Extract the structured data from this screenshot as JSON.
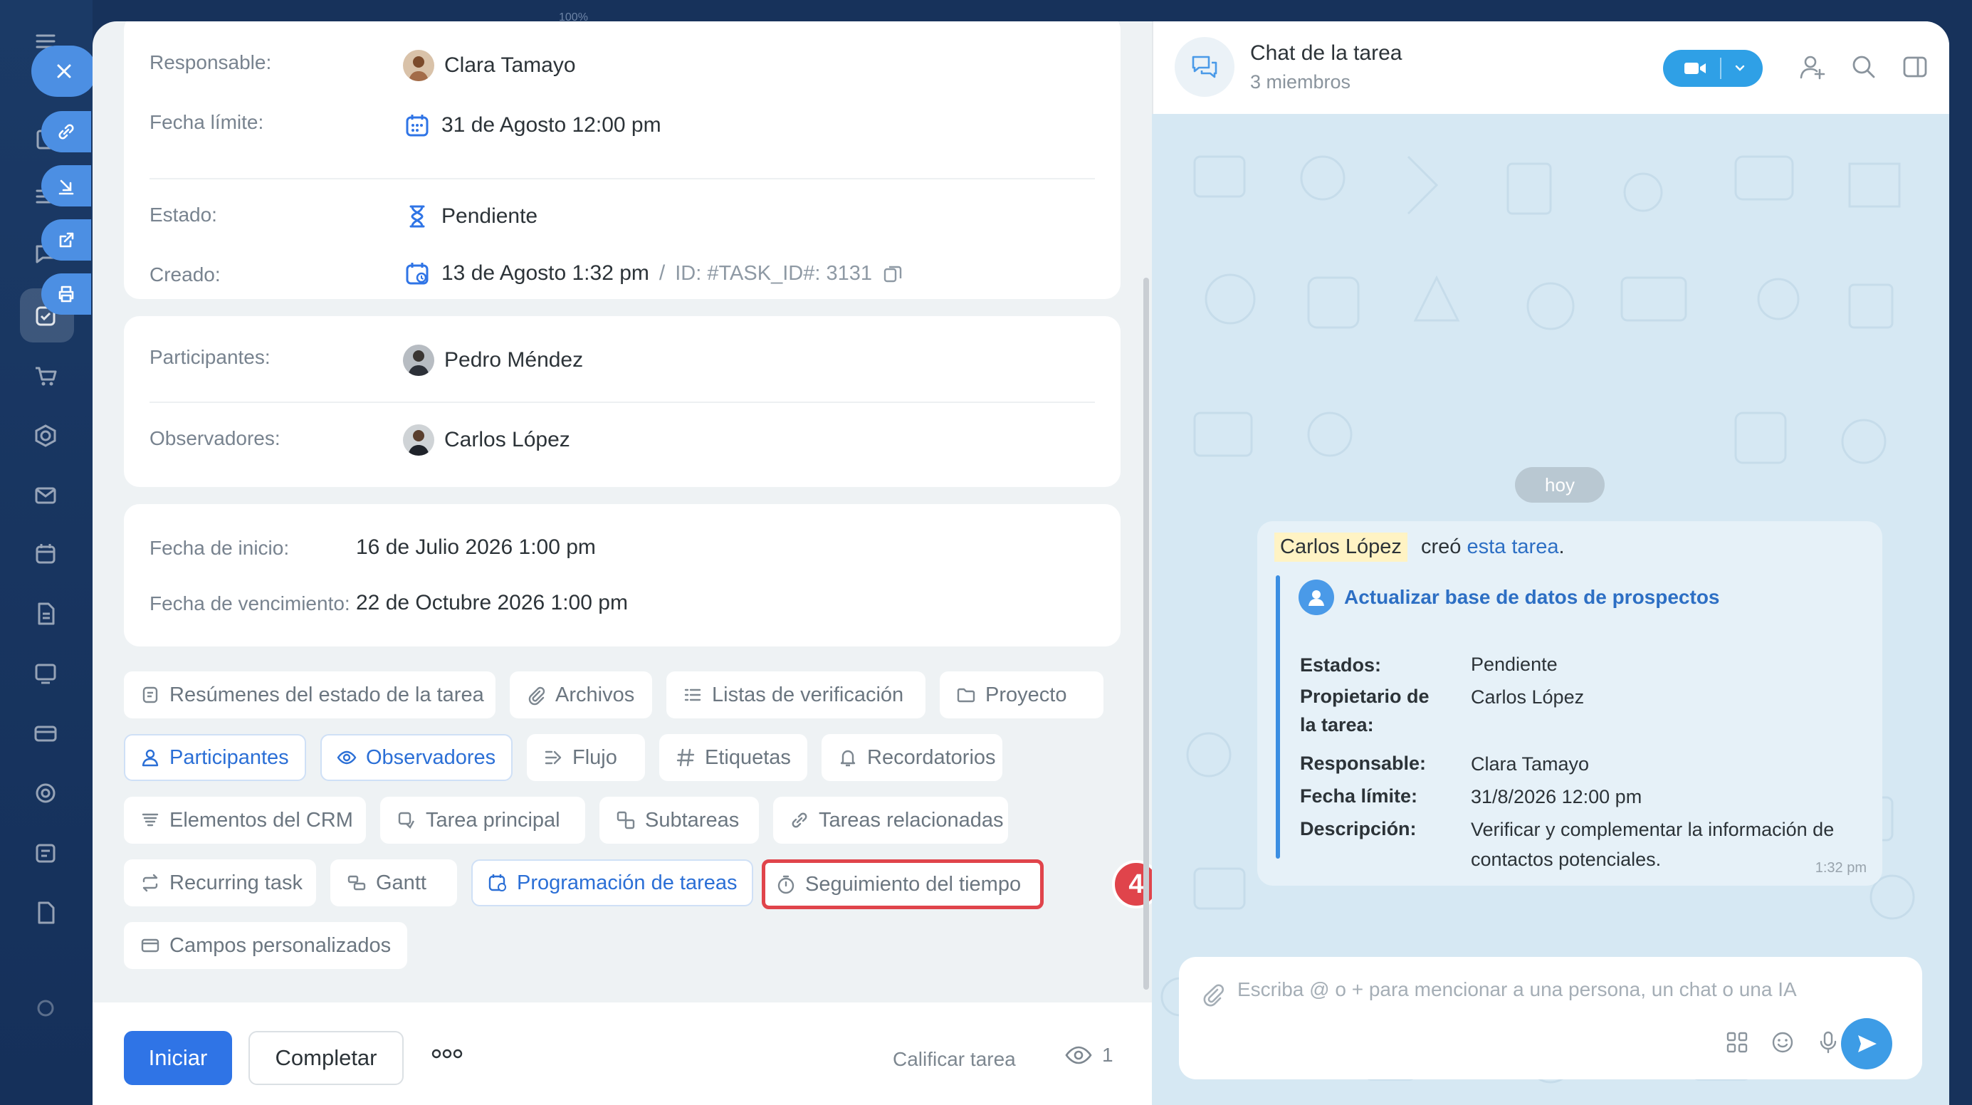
{
  "top_hint": "100%",
  "details": {
    "responsible_label": "Responsable:",
    "responsible_value": "Clara Tamayo",
    "deadline_label": "Fecha límite:",
    "deadline_value": "31 de Agosto 12:00 pm",
    "status_label": "Estado:",
    "status_value": "Pendiente",
    "created_label": "Creado:",
    "created_value": "13 de Agosto 1:32 pm",
    "created_separator": "/",
    "task_id": "ID: #TASK_ID#: 3131"
  },
  "people": {
    "participants_label": "Participantes:",
    "participants_value": "Pedro Méndez",
    "observers_label": "Observadores:",
    "observers_value": "Carlos López"
  },
  "dates": {
    "start_label": "Fecha de inicio:",
    "start_value": "16 de Julio 2026 1:00 pm",
    "due_label": "Fecha de vencimiento:",
    "due_value": "22 de Octubre 2026 1:00 pm"
  },
  "chips": {
    "summaries": "Resúmenes del estado de la tarea",
    "files": "Archivos",
    "checklists": "Listas de verificación",
    "project": "Proyecto",
    "participants": "Participantes",
    "observers": "Observadores",
    "flow": "Flujo",
    "tags": "Etiquetas",
    "reminders": "Recordatorios",
    "crm": "Elementos del CRM",
    "parent_task": "Tarea principal",
    "subtasks": "Subtareas",
    "related": "Tareas relacionadas",
    "recurring": "Recurring task",
    "gantt": "Gantt",
    "scheduling": "Programación de tareas",
    "time_tracking": "Seguimiento del tiempo",
    "custom_fields": "Campos personalizados"
  },
  "callout_number": "4",
  "footer": {
    "start": "Iniciar",
    "complete": "Completar",
    "rate": "Calificar tarea",
    "views": "1"
  },
  "chat": {
    "title": "Chat de la tarea",
    "members": "3 miembros",
    "day": "hoy",
    "author": "Carlos López",
    "action": "creó",
    "task_link": "esta tarea",
    "period": ".",
    "task_title": "Actualizar base de datos de prospectos",
    "states_label": "Estados:",
    "states_value": "Pendiente",
    "owner_label_1": "Propietario de",
    "owner_label_2": "la tarea:",
    "owner_value": "Carlos López",
    "responsible_label": "Responsable:",
    "responsible_value": "Clara Tamayo",
    "deadline_label": "Fecha límite:",
    "deadline_value": "31/8/2026 12:00 pm",
    "description_label": "Descripción:",
    "description_line1": "Verificar y complementar la información de",
    "description_line2": "contactos potenciales.",
    "time": "1:32 pm",
    "input_placeholder": "Escriba @ o + para mencionar a una persona, un chat o una IA"
  },
  "colors": {
    "primary": "#2f74e6",
    "highlight": "#e0444b",
    "chat_background": "#d6e8f3",
    "video_button": "#2fa0e6"
  }
}
